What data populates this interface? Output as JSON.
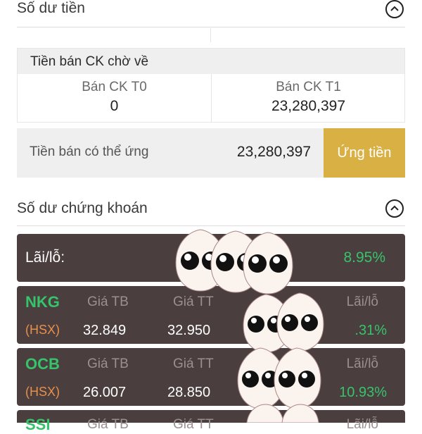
{
  "cash_section": {
    "title": "Số dư tiền"
  },
  "pending_sale": {
    "header": "Tiền bán CK chờ về",
    "t0_label": "Bán CK T0",
    "t0_value": "0",
    "t1_label": "Bán CK T1",
    "t1_value": "23,280,397"
  },
  "advance": {
    "label": "Tiền bán có thể ứng",
    "value": "23,280,397",
    "button": "Ứng tiền"
  },
  "securities_section": {
    "title": "Số dư chứng khoán"
  },
  "summary": {
    "label": "Lãi/lỗ:",
    "value": "8.95%"
  },
  "stocks": [
    {
      "symbol": "NKG",
      "exchange": "(HSX)",
      "avg_label": "Giá TB",
      "avg_value": "32.849",
      "cur_label": "Giá TT",
      "cur_value": "32.950",
      "pnl_label": "Lãi/lỗ",
      "pnl_value": ".31%"
    },
    {
      "symbol": "OCB",
      "exchange": "(HSX)",
      "avg_label": "Giá TB",
      "avg_value": "26.007",
      "cur_label": "Giá TT",
      "cur_value": "28.850",
      "pnl_label": "Lãi/lỗ",
      "pnl_value": "10.93%"
    },
    {
      "symbol": "SSI",
      "exchange": "",
      "avg_label": "Giá TB",
      "avg_value": "",
      "cur_label": "Giá TT",
      "cur_value": "",
      "pnl_label": "Lãi/lỗ",
      "pnl_value": ""
    }
  ],
  "colors": {
    "accent_gold": "#d9b043",
    "card_dark": "#4a3e3f",
    "gain_green": "#36c46b",
    "exchange_orange": "#e8904a"
  },
  "icons": [
    "chevron-up-icon",
    "sticker-icon"
  ]
}
